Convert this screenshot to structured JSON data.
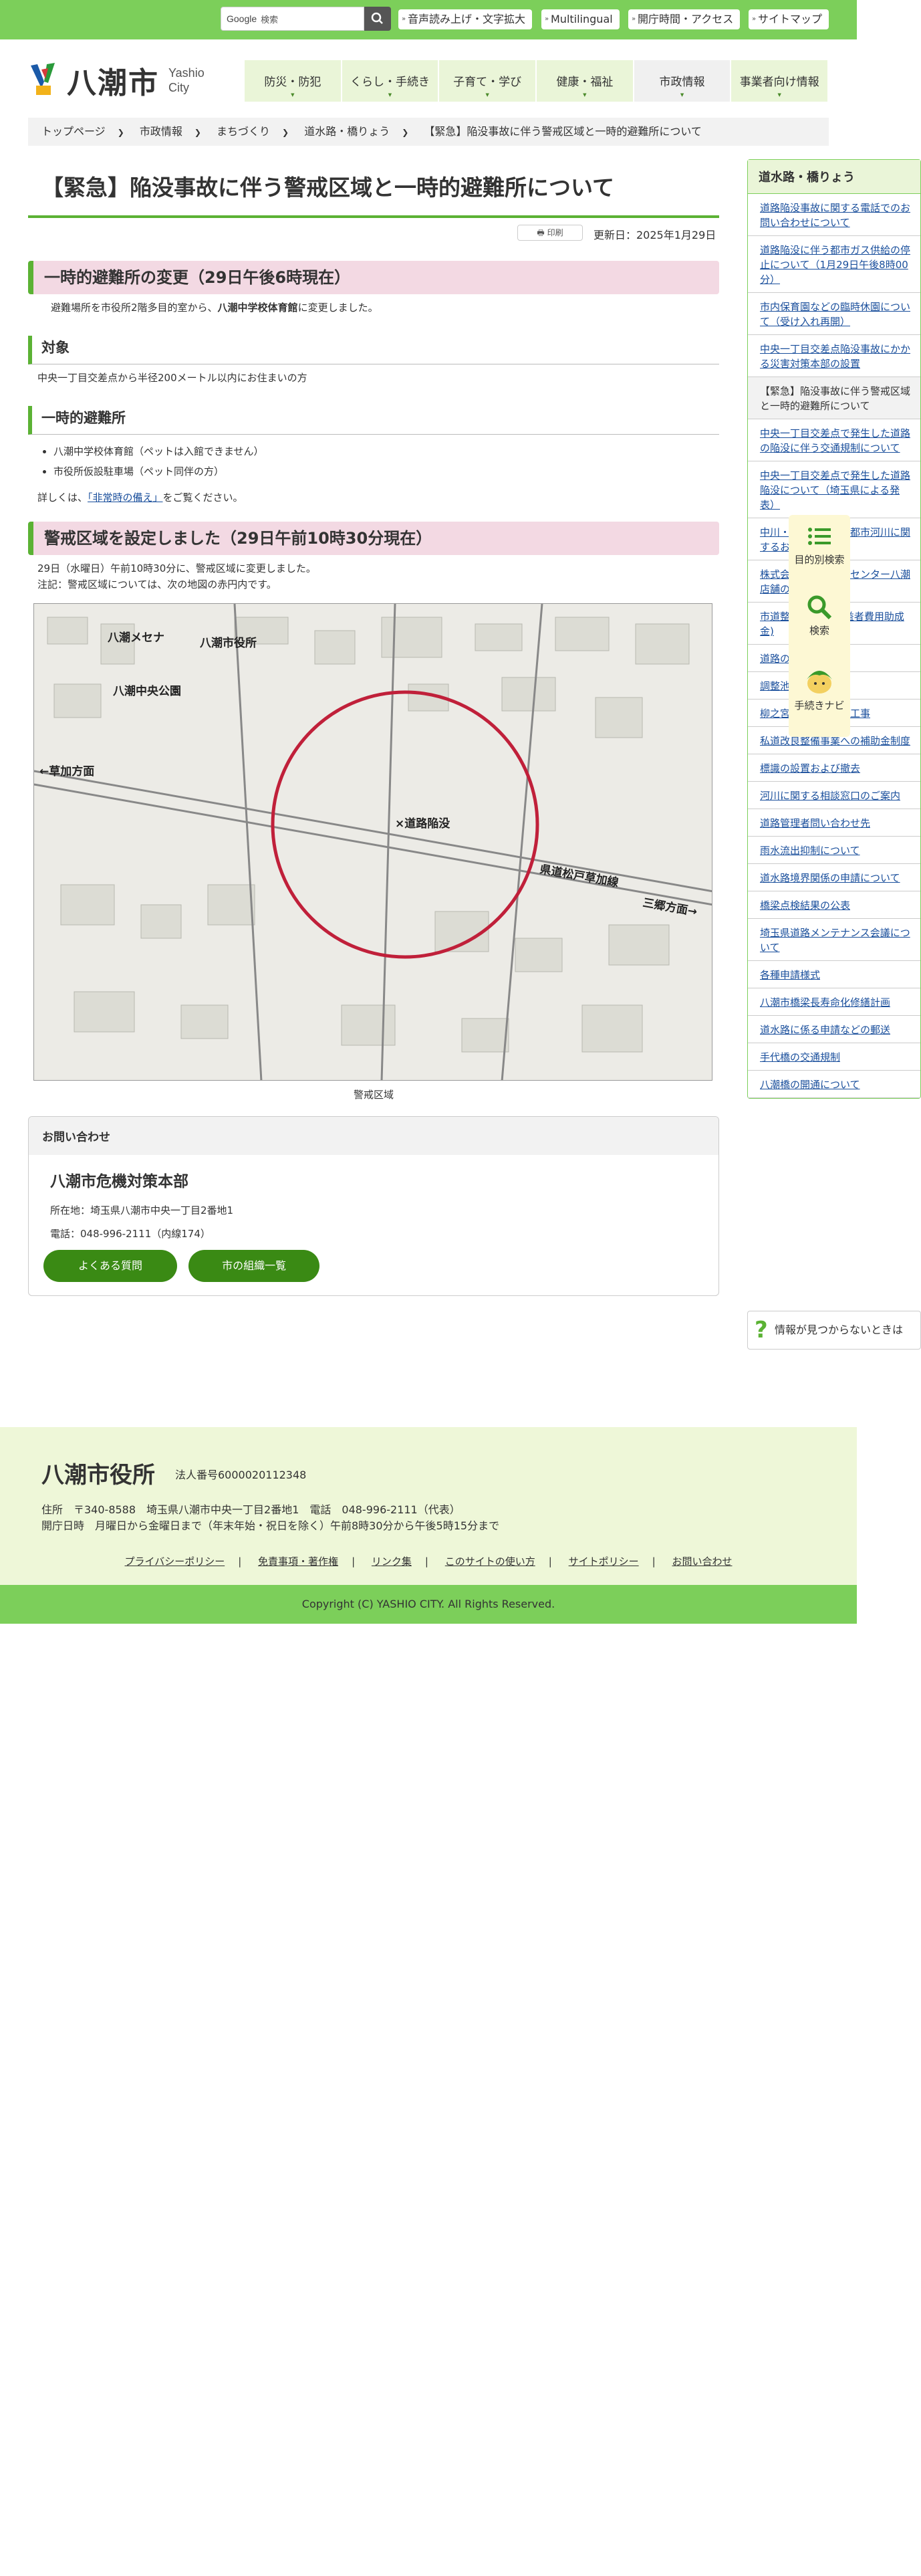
{
  "header": {
    "search_brand": "Google",
    "search_placeholder": "検索",
    "top_links": [
      "音声読み上げ・文字拡大",
      "Multilingual",
      "開庁時間・アクセス",
      "サイトマップ"
    ],
    "logo_title": "八潮市",
    "logo_sub": [
      "Yashio",
      "City"
    ]
  },
  "gnav": [
    "防災・防犯",
    "くらし・手続き",
    "子育て・学び",
    "健康・福祉",
    "市政情報",
    "事業者向け情報"
  ],
  "breadcrumb": [
    "トップページ",
    "市政情報",
    "まちづくり",
    "道水路・橋りょう",
    "【緊急】陥没事故に伴う警戒区域と一時的避難所について"
  ],
  "page": {
    "title": "【緊急】陥没事故に伴う警戒区域と一時的避難所について",
    "print": "印刷",
    "updated": "更新日：2025年1月29日"
  },
  "sections": {
    "s1_title": "一時的避難所の変更（29日午後6時現在）",
    "s1_text_pre": "避難場所を市役所2階多目的室から、",
    "s1_text_bold": "八潮中学校体育館",
    "s1_text_post": "に変更しました。",
    "target_title": "対象",
    "target_text": "中央一丁目交差点から半径200メートル以内にお住まいの方",
    "shelter_title": "一時的避難所",
    "shelter_items": [
      "八潮中学校体育館（ペットは入館できません）",
      "市役所仮設駐車場（ペット同伴の方）"
    ],
    "detail_pre": "詳しくは、",
    "detail_link": "「非常時の備え」",
    "detail_post": "をご覧ください。",
    "s2_title": "警戒区域を設定しました（29日午前10時30分現在）",
    "s2_line1": "29日（水曜日）午前10時30分に、警戒区域に変更しました。",
    "s2_line2": "注記：警戒区域については、次の地図の赤円内です。",
    "map_labels": [
      "八潮メセナ",
      "八潮市役所",
      "八潮中央公園",
      "←草加方面",
      "×道路陥没",
      "県道松戸草加線",
      "三郷方面→"
    ],
    "map_caption": "警戒区域"
  },
  "contact": {
    "head": "お問い合わせ",
    "dept": "八潮市危機対策本部",
    "address": "所在地：埼玉県八潮市中央一丁目2番地1",
    "phone": "電話：048-996-2111（内線174）",
    "btn_faq": "よくある質問",
    "btn_org": "市の組織一覧"
  },
  "sidebar": {
    "title": "道水路・橋りょう",
    "items": [
      "道路陥没事故に関する電話でのお問い合わせについて",
      "道路陥没に伴う都市ガス供給の停止について（1月29日午後8時00分）",
      "市内保育園などの臨時休園について（受け入れ再開）",
      "中央一丁目交差点陥没事故にかかる災害対策本部の設置",
      "【緊急】陥没事故に伴う警戒区域と一時的避難所について",
      "中央一丁目交差点で発生した道路の陥没に伴う交通規制について",
      "中央一丁目交差点で発生した道路陥没について（埼玉県による発表）",
      "中川・綾瀬川流域で都市河川に関するお知らせ",
      "株式会社フレッシュセンター八潮店舗の出店について",
      "市道整備の費用(受益者費用助成金)",
      "道路の占用許可",
      "調整池",
      "柳之宮橋の架け替え工事",
      "私道改良整備事業への補助金制度",
      "標識の設置および撤去",
      "河川に関する相談窓口のご案内",
      "道路管理者問い合わせ先",
      "雨水流出抑制について",
      "道水路境界関係の申請について",
      "橋梁点検結果の公表",
      "埼玉県道路メンテナンス会議について",
      "各種申請様式",
      "八潮市橋梁長寿命化修繕計画",
      "道水路に係る申請などの郵送",
      "手代橋の交通規制",
      "八潮橋の開通について"
    ],
    "help": "情報が見つからないときは"
  },
  "float": [
    "目的別検索",
    "検索",
    "手続きナビ"
  ],
  "footer": {
    "name": "八潮市役所",
    "corp": "法人番号6000020112348",
    "addr1": "住所　〒340-8588　埼玉県八潮市中央一丁目2番地1　電話　048-996-2111（代表）",
    "addr2": "開庁日時　月曜日から金曜日まで（年末年始・祝日を除く）午前8時30分から午後5時15分まで",
    "links": [
      "プライバシーポリシー",
      "免責事項・著作権",
      "リンク集",
      "このサイトの使い方",
      "サイトポリシー",
      "お問い合わせ"
    ],
    "copyright": "Copyright (C) YASHIO CITY. All Rights Reserved."
  },
  "colors": {
    "brand_green": "#7ccf5a",
    "accent_green": "#5bb234",
    "button_green": "#3a8a14",
    "heading_pink": "#f3d9e3",
    "circle_red": "#c0203a"
  }
}
